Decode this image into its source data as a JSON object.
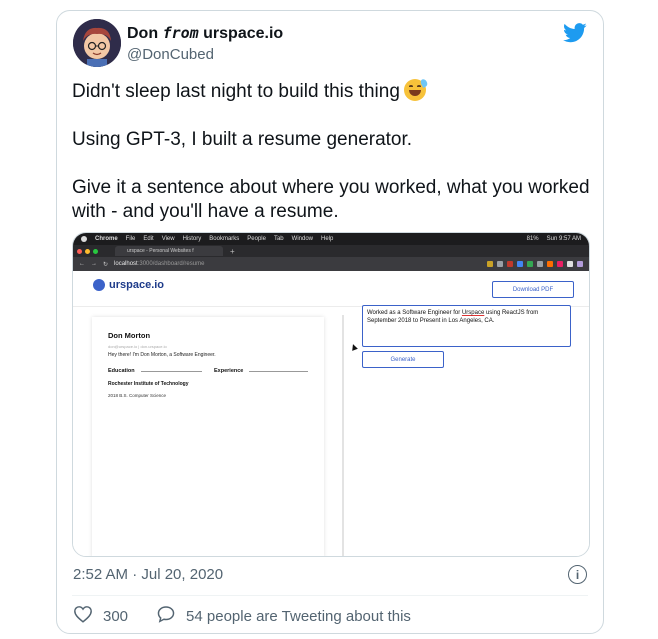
{
  "author": {
    "name_prefix": "Don",
    "name_from": "from",
    "name_suffix": "urspace.io",
    "handle": "@DonCubed"
  },
  "tweet": {
    "line1": "Didn't sleep last night to build this thing",
    "line2": "Using GPT-3, I built a resume generator.",
    "line3": "Give it a sentence about where you worked, what you worked with - and you'll have a resume."
  },
  "media": {
    "mac_menu": [
      "Chrome",
      "File",
      "Edit",
      "View",
      "History",
      "Bookmarks",
      "People",
      "Tab",
      "Window",
      "Help"
    ],
    "battery": "81%",
    "clock": "Sun 9:57 AM",
    "tab_title": "urspace - Personal Websites f",
    "url_host": "localhost",
    "url_rest": ":3000/dashboard/resume",
    "logo_text": "urspace.io",
    "download_button": "Download PDF",
    "resume": {
      "name": "Don Morton",
      "subline": "don@urspace.io | don.urspace.io",
      "intro": "Hey there! I'm Don Morton, a Software Engineer.",
      "education_heading": "Education",
      "experience_heading": "Experience",
      "school": "Rochester Institute of Technology",
      "degree": "2018 B.S. Computer Science"
    },
    "input_before": "Worked as a Software Engineer for ",
    "input_brand": "Urspace",
    "input_after": " using ReactJS from September 2018 to Present in Los Angeles, CA.",
    "generate_button": "Generate"
  },
  "footer": {
    "timestamp": "2:52 AM · Jul 20, 2020",
    "likes": "300",
    "retweet_text": "54 people are Tweeting about this",
    "info_label": "i"
  },
  "colors": {
    "twitter_blue": "#1d9bf0",
    "accent_blue": "#3b62c9",
    "text_secondary": "#536471"
  }
}
